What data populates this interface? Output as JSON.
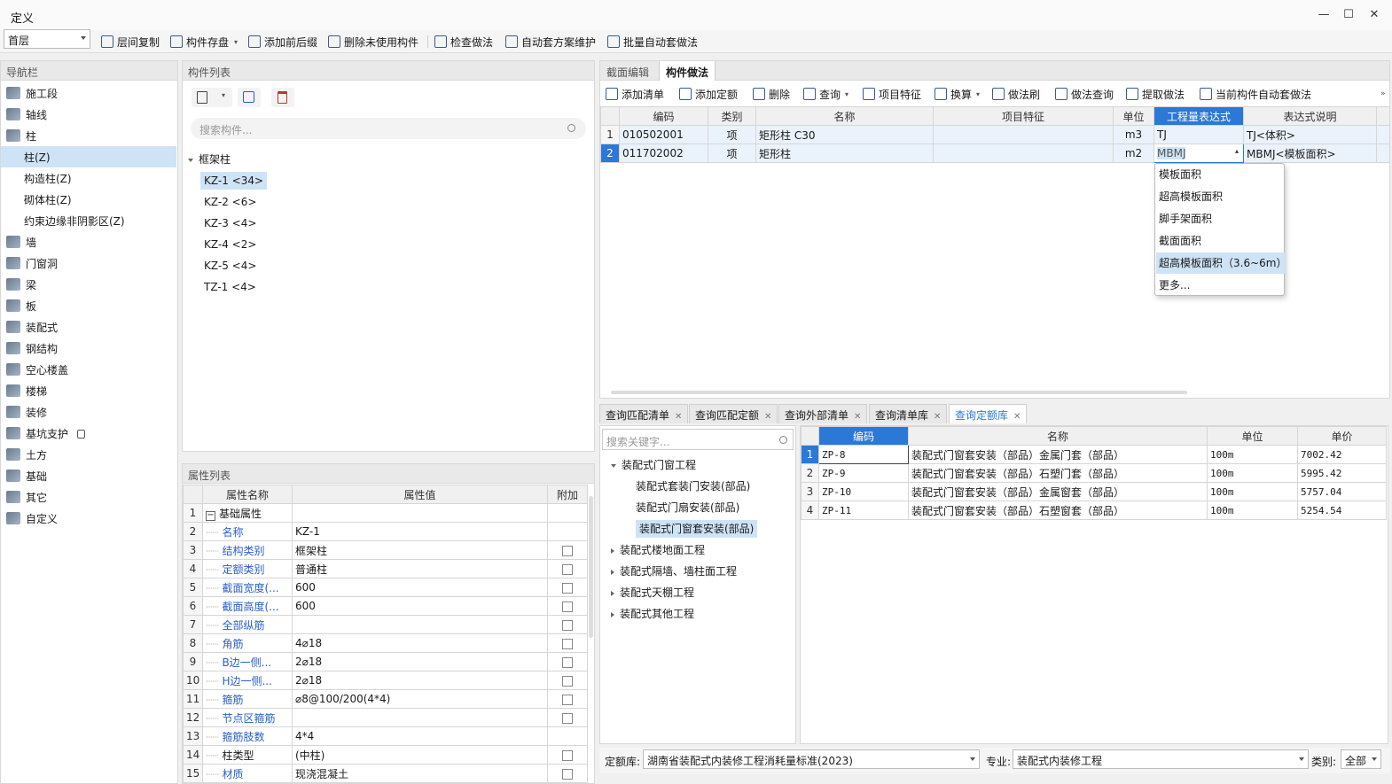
{
  "window": {
    "title": "定义"
  },
  "toolbar": {
    "floor": "首层",
    "buttons": [
      "层间复制",
      "构件存盘",
      "添加前后缀",
      "删除未使用构件",
      "检查做法",
      "自动套方案维护",
      "批量自动套做法"
    ]
  },
  "nav": {
    "header": "导航栏",
    "items": [
      {
        "label": "施工段",
        "sub": false
      },
      {
        "label": "轴线",
        "sub": false
      },
      {
        "label": "柱",
        "sub": false
      },
      {
        "label": "柱(Z)",
        "sub": true,
        "selected": true
      },
      {
        "label": "构造柱(Z)",
        "sub": true
      },
      {
        "label": "砌体柱(Z)",
        "sub": true
      },
      {
        "label": "约束边缘非阴影区(Z)",
        "sub": true
      },
      {
        "label": "墙",
        "sub": false
      },
      {
        "label": "门窗洞",
        "sub": false
      },
      {
        "label": "梁",
        "sub": false
      },
      {
        "label": "板",
        "sub": false
      },
      {
        "label": "装配式",
        "sub": false
      },
      {
        "label": "钢结构",
        "sub": false
      },
      {
        "label": "空心楼盖",
        "sub": false
      },
      {
        "label": "楼梯",
        "sub": false
      },
      {
        "label": "装修",
        "sub": false
      },
      {
        "label": "基坑支护",
        "sub": false,
        "lock": true
      },
      {
        "label": "土方",
        "sub": false
      },
      {
        "label": "基础",
        "sub": false
      },
      {
        "label": "其它",
        "sub": false
      },
      {
        "label": "自定义",
        "sub": false
      }
    ]
  },
  "components": {
    "header": "构件列表",
    "search_placeholder": "搜索构件...",
    "group": "框架柱",
    "items": [
      "KZ-1 <34>",
      "KZ-2 <6>",
      "KZ-3 <4>",
      "KZ-4 <2>",
      "KZ-5 <4>",
      "TZ-1 <4>"
    ]
  },
  "properties": {
    "header": "属性列表",
    "columns": [
      "属性名称",
      "属性值",
      "附加"
    ],
    "rows": [
      {
        "n": "1",
        "name": "基础属性",
        "value": "",
        "group": true,
        "check": false
      },
      {
        "n": "2",
        "name": "名称",
        "value": "KZ-1",
        "check": false
      },
      {
        "n": "3",
        "name": "结构类别",
        "value": "框架柱",
        "check": true
      },
      {
        "n": "4",
        "name": "定额类别",
        "value": "普通柱",
        "check": true
      },
      {
        "n": "5",
        "name": "截面宽度(...",
        "value": "600",
        "check": true
      },
      {
        "n": "6",
        "name": "截面高度(...",
        "value": "600",
        "check": true
      },
      {
        "n": "7",
        "name": "全部纵筋",
        "value": "",
        "check": true
      },
      {
        "n": "8",
        "name": "角筋",
        "value": "4⌀18",
        "check": true
      },
      {
        "n": "9",
        "name": "B边一侧...",
        "value": "2⌀18",
        "check": true
      },
      {
        "n": "10",
        "name": "H边一侧...",
        "value": "2⌀18",
        "check": true
      },
      {
        "n": "11",
        "name": "箍筋",
        "value": "⌀8@100/200(4*4)",
        "check": true
      },
      {
        "n": "12",
        "name": "节点区箍筋",
        "value": "",
        "check": true
      },
      {
        "n": "13",
        "name": "箍筋肢数",
        "value": "4*4",
        "check": false
      },
      {
        "n": "14",
        "name": "柱类型",
        "value": "(中柱)",
        "black": true,
        "check": true
      },
      {
        "n": "15",
        "name": "材质",
        "value": "现浇混凝土",
        "check": true
      }
    ]
  },
  "method": {
    "tabs": [
      "截面编辑",
      "构件做法"
    ],
    "active_tab": "构件做法",
    "toolbar": [
      "添加清单",
      "添加定额",
      "删除",
      "查询",
      "项目特征",
      "换算",
      "做法刷",
      "做法查询",
      "提取做法",
      "当前构件自动套做法"
    ],
    "columns": [
      "编码",
      "类别",
      "名称",
      "项目特征",
      "单位",
      "工程量表达式",
      "表达式说明"
    ],
    "rows": [
      {
        "n": "1",
        "code": "010502001",
        "type": "项",
        "name": "矩形柱 C30",
        "feature": "",
        "unit": "m3",
        "expr": "TJ",
        "desc": "TJ<体积>"
      },
      {
        "n": "2",
        "code": "011702002",
        "type": "项",
        "name": "矩形柱",
        "feature": "",
        "unit": "m2",
        "expr": "MBMJ",
        "desc": "MBMJ<模板面积>"
      }
    ],
    "dropdown": [
      "模板面积",
      "超高模板面积",
      "脚手架面积",
      "截面面积",
      "超高模板面积（3.6~6m）",
      "更多..."
    ],
    "dropdown_highlight": 4
  },
  "query": {
    "tabs": [
      "查询匹配清单",
      "查询匹配定额",
      "查询外部清单",
      "查询清单库",
      "查询定额库"
    ],
    "active_tab": "查询定额库",
    "search_placeholder": "搜索关键字...",
    "tree": [
      {
        "label": "装配式门窗工程",
        "level": 0,
        "expanded": true
      },
      {
        "label": "装配式套装门安装(部品)",
        "level": 1
      },
      {
        "label": "装配式门扇安装(部品)",
        "level": 1
      },
      {
        "label": "装配式门窗套安装(部品)",
        "level": 1,
        "selected": true
      },
      {
        "label": "装配式楼地面工程",
        "level": 0
      },
      {
        "label": "装配式隔墙、墙柱面工程",
        "level": 0
      },
      {
        "label": "装配式天棚工程",
        "level": 0
      },
      {
        "label": "装配式其他工程",
        "level": 0
      }
    ],
    "columns": [
      "编码",
      "名称",
      "单位",
      "单价"
    ],
    "rows": [
      {
        "n": "1",
        "code": "ZP-8",
        "name": "装配式门窗套安装（部品）金属门套（部品）",
        "unit": "100m",
        "price": "7002.42"
      },
      {
        "n": "2",
        "code": "ZP-9",
        "name": "装配式门窗套安装（部品）石塑门套（部品）",
        "unit": "100m",
        "price": "5995.42"
      },
      {
        "n": "3",
        "code": "ZP-10",
        "name": "装配式门窗套安装（部品）金属窗套（部品）",
        "unit": "100m",
        "price": "5757.04"
      },
      {
        "n": "4",
        "code": "ZP-11",
        "name": "装配式门窗套安装（部品）石塑窗套（部品）",
        "unit": "100m",
        "price": "5254.54"
      }
    ],
    "footer": {
      "lib_label": "定额库:",
      "lib_value": "湖南省装配式内装修工程消耗量标准(2023)",
      "major_label": "专业:",
      "major_value": "装配式内装修工程",
      "cat_label": "类别:",
      "cat_value": "全部"
    }
  }
}
